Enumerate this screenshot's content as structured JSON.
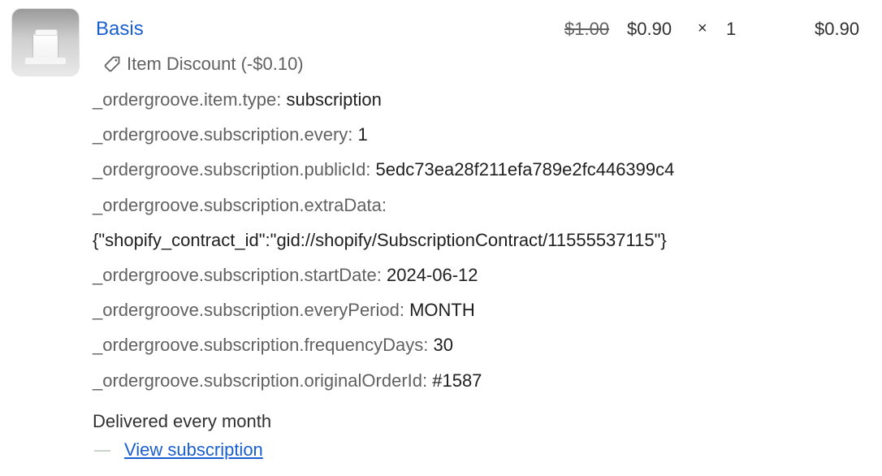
{
  "product": {
    "title": "Basis",
    "thumbnail": "product-thumbnail-image",
    "discount_label": "Item Discount (-$0.10)",
    "discount_icon": "tag-icon",
    "original_price": "$1.00",
    "current_price": "$0.90",
    "multiply_symbol": "×",
    "quantity": "1",
    "line_total": "$0.90"
  },
  "properties": [
    {
      "key": "_ordergroove.item.type:",
      "value": "subscription"
    },
    {
      "key": "_ordergroove.subscription.every:",
      "value": "1"
    },
    {
      "key": "_ordergroove.subscription.publicId:",
      "value": "5edc73ea28f211efa789e2fc446399c4"
    },
    {
      "key": "_ordergroove.subscription.extraData:",
      "value": ""
    },
    {
      "key": "",
      "value": "{\"shopify_contract_id\":\"gid://shopify/SubscriptionContract/11555537115\"}"
    },
    {
      "key": "_ordergroove.subscription.startDate:",
      "value": "2024-06-12"
    },
    {
      "key": "_ordergroove.subscription.everyPeriod:",
      "value": "MONTH"
    },
    {
      "key": "_ordergroove.subscription.frequencyDays:",
      "value": "30"
    },
    {
      "key": "_ordergroove.subscription.originalOrderId:",
      "value": "#1587"
    }
  ],
  "subscription": {
    "delivery_text": "Delivered every month",
    "link_label": "View subscription"
  },
  "colors": {
    "link": "#1a5fd1",
    "muted_text": "#616161",
    "text": "#303030"
  }
}
